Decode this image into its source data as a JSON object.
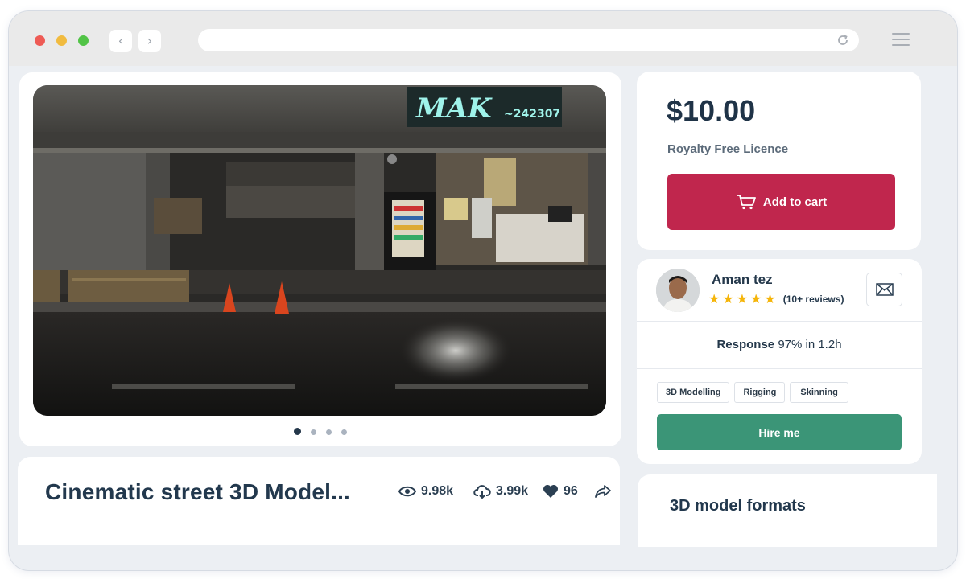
{
  "browser": {
    "back_icon": "‹",
    "forward_icon": "›",
    "url": "",
    "reload_icon": "reload-icon",
    "menu_icon": "hamburger-icon"
  },
  "preview": {
    "scene_sign": "MAK",
    "scene_sign_number": "~242307",
    "carousel_total": 4,
    "carousel_active": 1
  },
  "model": {
    "title": "Cinematic street 3D Model...",
    "views": "9.98k",
    "downloads": "3.99k",
    "likes": "96",
    "share_icon": "share-icon"
  },
  "pricing": {
    "price": "$10.00",
    "licence": "Royalty Free Licence",
    "cart_label": "Add to cart"
  },
  "seller": {
    "name": "Aman tez",
    "rating": 5,
    "reviews": "(10+ reviews)",
    "response_label": "Response",
    "response_value": "97% in 1.2h",
    "skills": [
      "3D Modelling",
      "Rigging",
      "Skinning"
    ],
    "hire_label": "Hire me"
  },
  "formats": {
    "title": "3D model formats"
  },
  "colors": {
    "cart_button": "#c0264d",
    "hire_button": "#3b9577",
    "star": "#f5b50a",
    "heading": "#22384d"
  }
}
